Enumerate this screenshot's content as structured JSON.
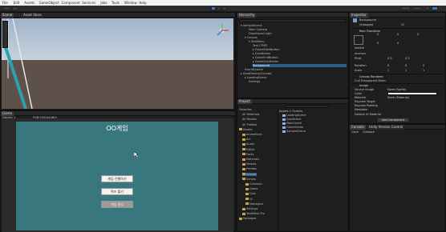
{
  "menubar": {
    "items": [
      "File",
      "Edit",
      "Assets",
      "GameObject",
      "Component",
      "Services",
      "Jobs",
      "Tools",
      "Window",
      "Help"
    ]
  },
  "scene_tabs": {
    "scene": "Scene",
    "asset_store": "Asset Store"
  },
  "game_tabs": {
    "game": "Game",
    "display": "Display 1",
    "aspect": "FHD(1920x1080)"
  },
  "game_ui": {
    "title": "OO게임",
    "buttons": [
      "게임 진행하기",
      "퀴즈 풀기",
      "게임 종료"
    ]
  },
  "hierarchy": {
    "tab": "Hierarchy",
    "rows": [
      {
        "text": "▾ SampleScene",
        "selected": false,
        "indent": 0
      },
      {
        "text": "Main Camera",
        "selected": false,
        "indent": 2
      },
      {
        "text": "Directional Light",
        "selected": false,
        "indent": 2
      },
      {
        "text": "▾ Canvas",
        "selected": false,
        "indent": 1
      },
      {
        "text": "▾ TextMenu",
        "selected": false,
        "indent": 2
      },
      {
        "text": "Text (TMP)",
        "selected": false,
        "indent": 3
      },
      {
        "text": "▸ GameStartButton",
        "selected": false,
        "indent": 3
      },
      {
        "text": "▸ QuizButton",
        "selected": false,
        "indent": 3
      },
      {
        "text": "▸ GameEndButton",
        "selected": false,
        "indent": 3
      },
      {
        "text": "▸ GameQuitButton",
        "selected": false,
        "indent": 3
      },
      {
        "text": "Background",
        "selected": true,
        "indent": 3
      },
      {
        "text": "EventSystem",
        "selected": false,
        "indent": 1
      },
      {
        "text": "▸ DontDestroyOnLoad",
        "selected": false,
        "indent": 0
      },
      {
        "text": "▸ LoadingScene",
        "selected": false,
        "indent": 1
      },
      {
        "text": "Settings",
        "selected": false,
        "indent": 2
      }
    ]
  },
  "project": {
    "tab": "Project",
    "breadcrumb": "Assets > Scenes",
    "tree": [
      {
        "text": "Favorites",
        "indent": 0,
        "folder": false
      },
      {
        "text": "All Materials",
        "indent": 1,
        "folder": false
      },
      {
        "text": "All Models",
        "indent": 1,
        "folder": false
      },
      {
        "text": "All Prefabs",
        "indent": 1,
        "folder": false
      },
      {
        "text": "Assets",
        "indent": 0,
        "folder": true
      },
      {
        "text": "Animations",
        "indent": 1,
        "folder": true
      },
      {
        "text": "Art",
        "indent": 1,
        "folder": true
      },
      {
        "text": "Audio",
        "indent": 1,
        "folder": true
      },
      {
        "text": "Editor",
        "indent": 1,
        "folder": true
      },
      {
        "text": "Fonts",
        "indent": 1,
        "folder": true
      },
      {
        "text": "Materials",
        "indent": 1,
        "folder": true
      },
      {
        "text": "Models",
        "indent": 1,
        "folder": true
      },
      {
        "text": "Prefabs",
        "indent": 1,
        "folder": true
      },
      {
        "text": "Scenes",
        "indent": 1,
        "folder": true,
        "selected": true
      },
      {
        "text": "Scripts",
        "indent": 1,
        "folder": true
      },
      {
        "text": "Common",
        "indent": 2,
        "folder": true
      },
      {
        "text": "Game",
        "indent": 2,
        "folder": true
      },
      {
        "text": "Quiz",
        "indent": 2,
        "folder": true
      },
      {
        "text": "UI",
        "indent": 2,
        "folder": true
      },
      {
        "text": "Managers",
        "indent": 2,
        "folder": true
      },
      {
        "text": "Settings",
        "indent": 1,
        "folder": true
      },
      {
        "text": "TextMesh Pro",
        "indent": 1,
        "folder": true
      },
      {
        "text": "Packages",
        "indent": 0,
        "folder": true
      }
    ],
    "files": [
      "LoadingScene",
      "QuizScene",
      "MainScene",
      "GameScene",
      "SampleScene"
    ]
  },
  "inspector": {
    "tab": "Inspector",
    "object_name": "Background",
    "tag": "Untagged",
    "layer": "UI",
    "rect_transform": {
      "title": "Rect Transform",
      "mode": "stretch",
      "left": "0",
      "top": "0",
      "pos_z": "0",
      "right": "0",
      "bottom": "0",
      "anchors": "Anchors",
      "pivot_label": "Pivot",
      "pivot_x": "0.5",
      "pivot_y": "0.5",
      "rotation_label": "Rotation",
      "rot_x": "0",
      "rot_y": "0",
      "rot_z": "0",
      "scale_label": "Scale",
      "scale_x": "1",
      "scale_y": "1",
      "scale_z": "1"
    },
    "canvas_renderer": {
      "title": "Canvas Renderer",
      "cull": "Cull Transparent Mesh"
    },
    "image": {
      "title": "Image",
      "source_image": "Source Image",
      "source_value": "None (Sprite)",
      "color": "Color",
      "color_value": "#FFFFFF",
      "material": "Material",
      "material_value": "None (Material)",
      "raycast": "Raycast Target",
      "raycast_padding": "Raycast Padding",
      "maskable": "Maskable"
    },
    "default_material": "Default UI Material",
    "add_component": "Add Component"
  },
  "console": {
    "tabs": [
      "Console",
      "Unity Version Control"
    ],
    "buttons": [
      "Clear",
      "Collapse"
    ]
  },
  "colors": {
    "game_bg": "#39777e",
    "sky": "#b4c4d4",
    "ground": "#5e5149",
    "accent": "#3a79c6"
  }
}
